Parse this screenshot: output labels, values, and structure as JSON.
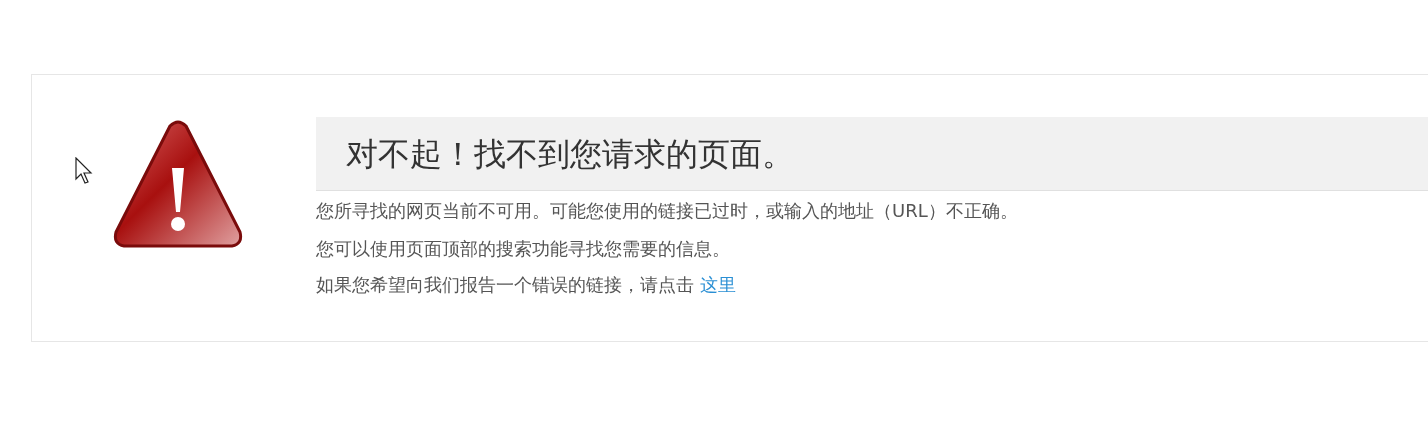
{
  "error_card": {
    "title": "对不起！找不到您请求的页面。",
    "lines": [
      {
        "text": "您所寻找的网页当前不可用。可能您使用的链接已过时，或输入的地址（URL）不正确。"
      },
      {
        "text": "您可以使用页面顶部的搜索功能寻找您需要的信息。"
      },
      {
        "text": "如果您希望向我们报告一个错误的链接，请点击 ",
        "link": "这里"
      }
    ]
  }
}
